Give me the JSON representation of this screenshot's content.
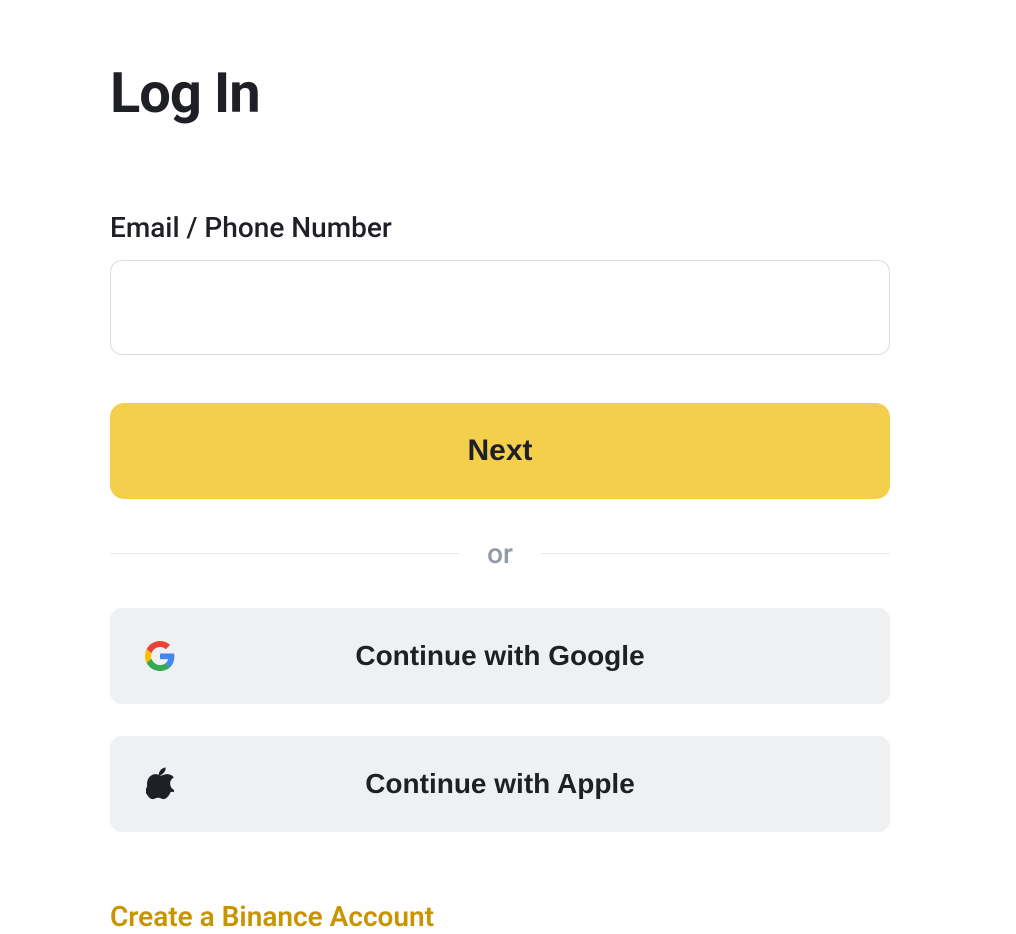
{
  "title": "Log In",
  "form": {
    "email_label": "Email / Phone Number",
    "email_value": "",
    "next_label": "Next"
  },
  "divider_text": "or",
  "social": {
    "google_label": "Continue with Google",
    "apple_label": "Continue with Apple"
  },
  "create_link": "Create a Binance Account"
}
